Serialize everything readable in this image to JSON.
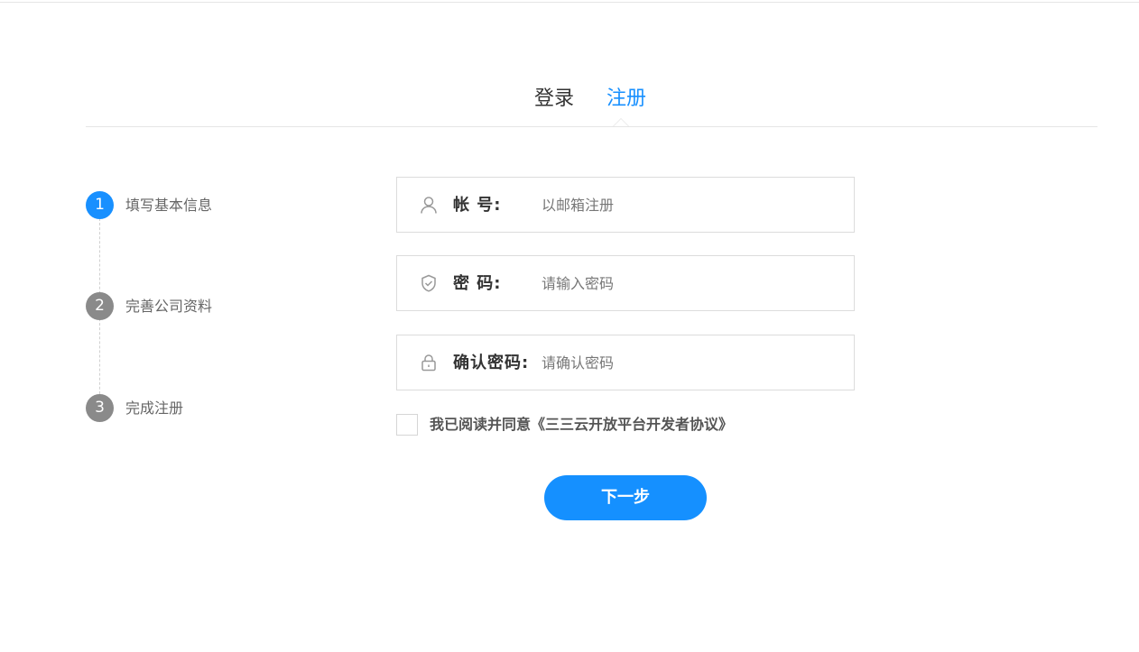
{
  "tabs": {
    "login": "登录",
    "register": "注册",
    "active": "register"
  },
  "steps": [
    {
      "number": "1",
      "label": "填写基本信息",
      "active": true
    },
    {
      "number": "2",
      "label": "完善公司资料",
      "active": false
    },
    {
      "number": "3",
      "label": "完成注册",
      "active": false
    }
  ],
  "form": {
    "account": {
      "label": "帐 号:",
      "placeholder": "以邮箱注册",
      "value": "",
      "icon": "user-icon"
    },
    "password": {
      "label": "密 码:",
      "placeholder": "请输入密码",
      "value": "",
      "icon": "shield-check-icon"
    },
    "confirm": {
      "label": "确认密码:",
      "placeholder": "请确认密码",
      "value": "",
      "icon": "lock-icon"
    },
    "agreement": {
      "text": "我已阅读并同意《三三云开放平台开发者协议》",
      "checked": false
    },
    "next_label": "下一步"
  },
  "colors": {
    "accent": "#1890ff",
    "step_inactive": "#8a8a8a",
    "border": "#dcdcdc"
  }
}
